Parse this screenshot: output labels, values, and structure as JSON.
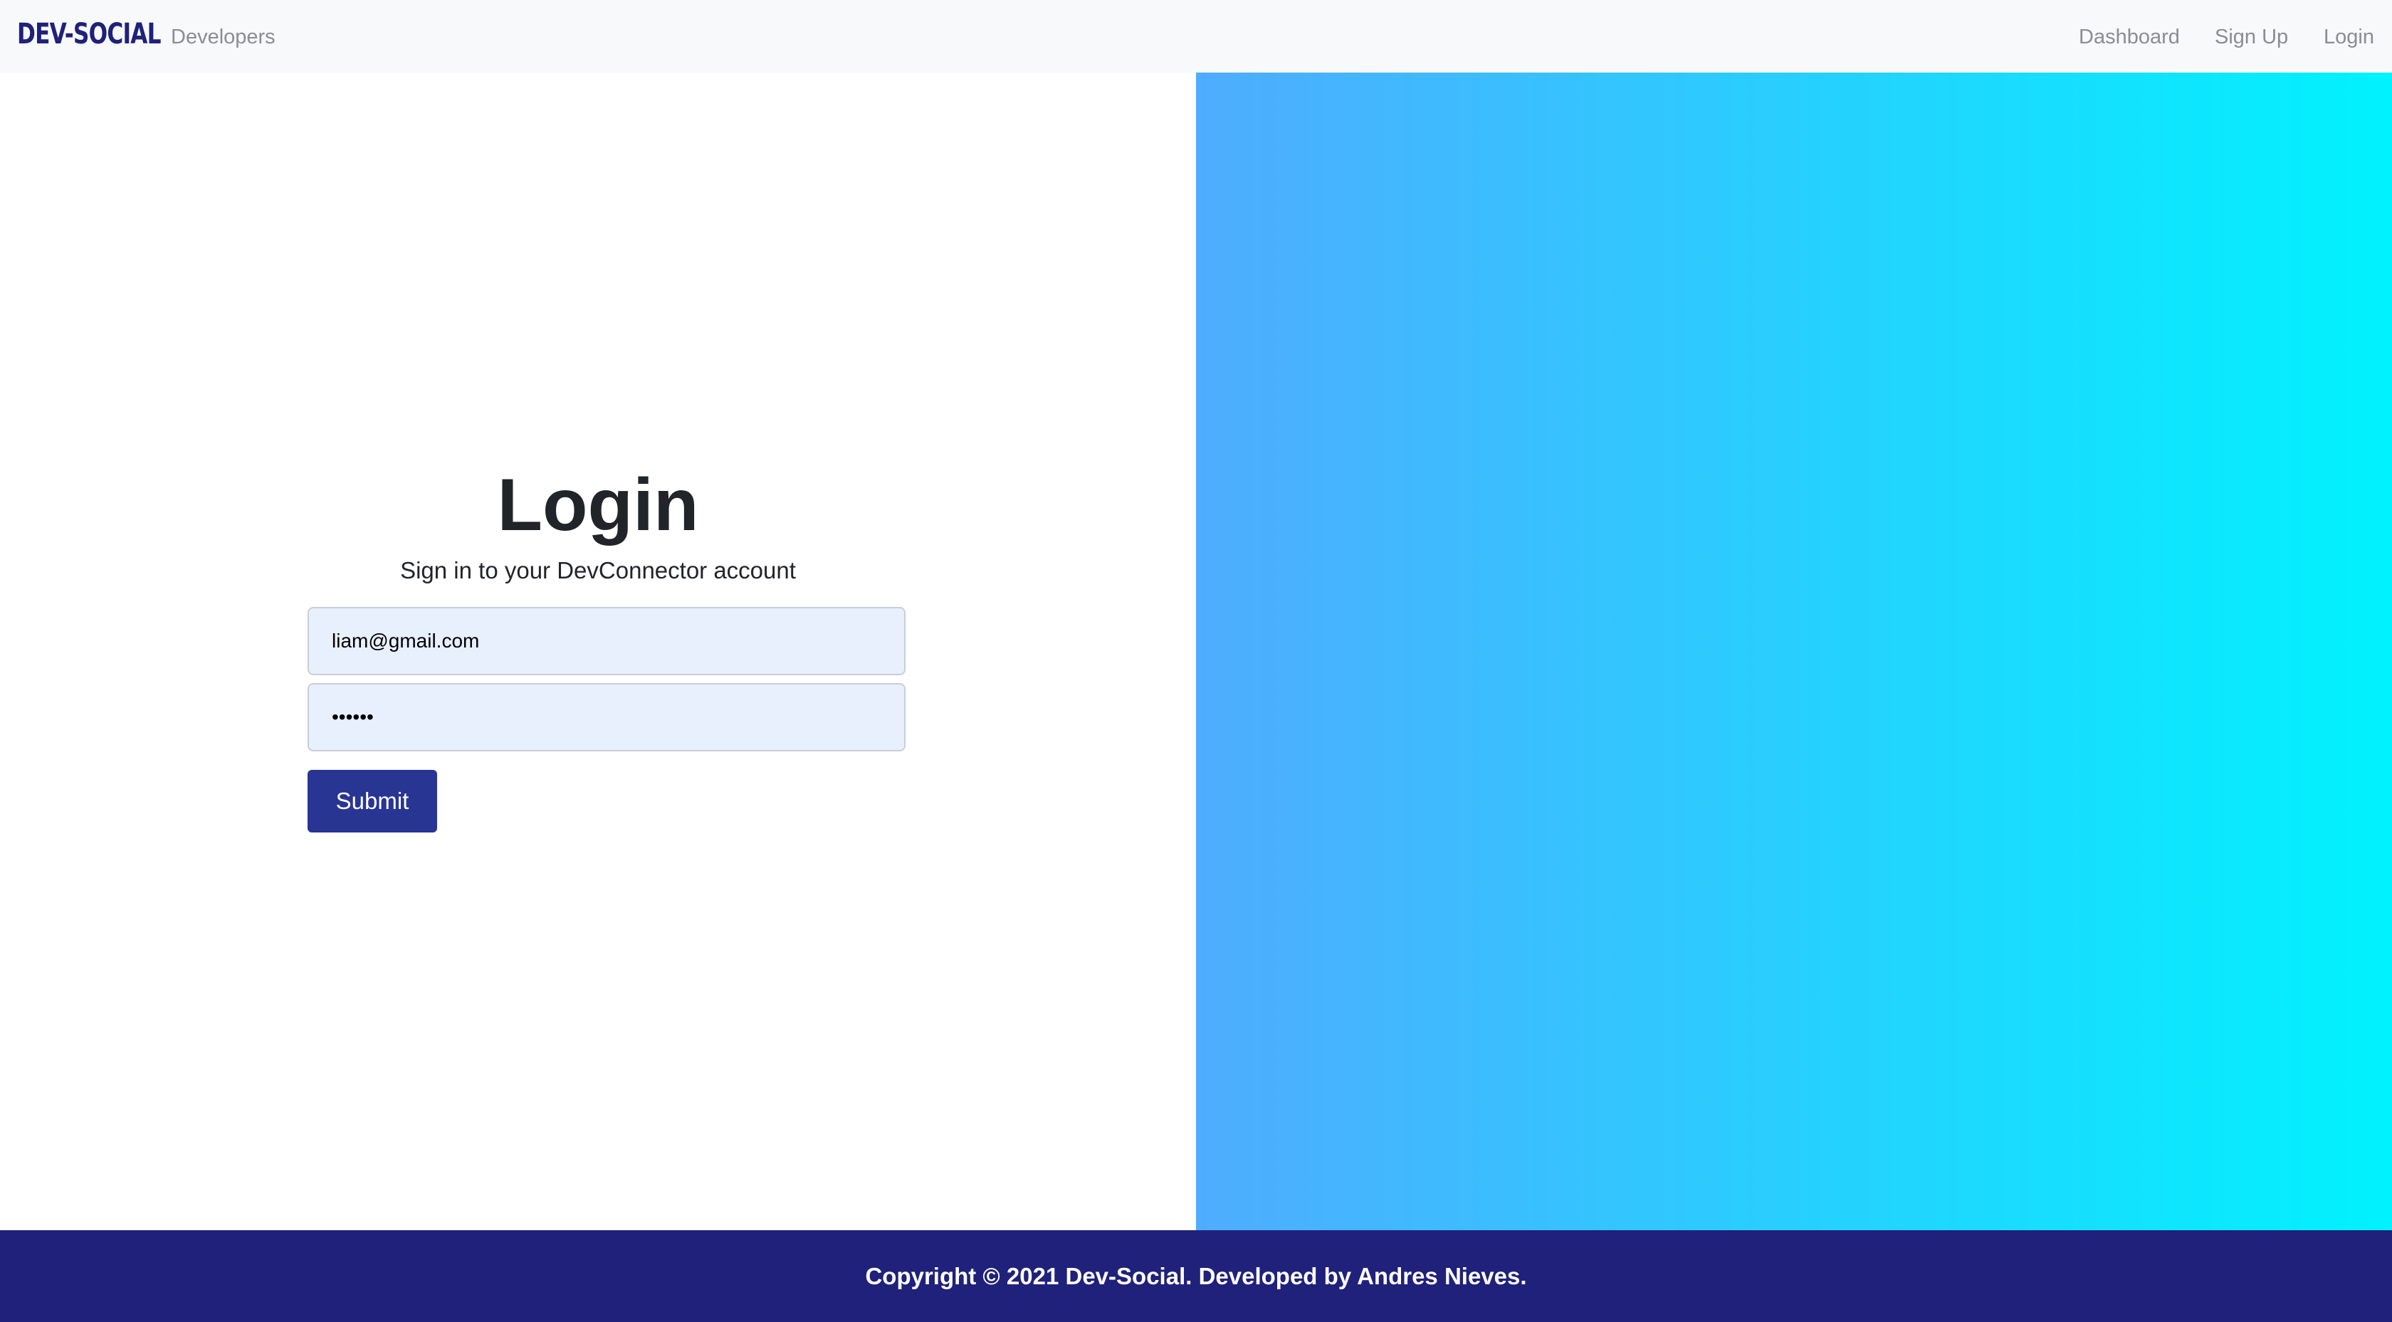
{
  "nav": {
    "brand": "DEV-SOCIAL",
    "developers": "Developers",
    "dashboard": "Dashboard",
    "signup": "Sign Up",
    "login": "Login"
  },
  "login": {
    "title": "Login",
    "subtitle": "Sign in to your DevConnector account",
    "email_value": "liam@gmail.com",
    "password_value": "••••••",
    "submit_label": "Submit"
  },
  "footer": {
    "text": "Copyright © 2021 Dev-Social. Developed by Andres Nieves."
  },
  "colors": {
    "brand": "#20217a",
    "nav_bg": "#f8f9fa",
    "nav_link": "#8a8d91",
    "input_bg": "#e8f0fe",
    "submit_bg": "#283593",
    "gradient_start": "#4facfe",
    "gradient_end": "#00f2fe",
    "footer_bg": "#20217a"
  }
}
